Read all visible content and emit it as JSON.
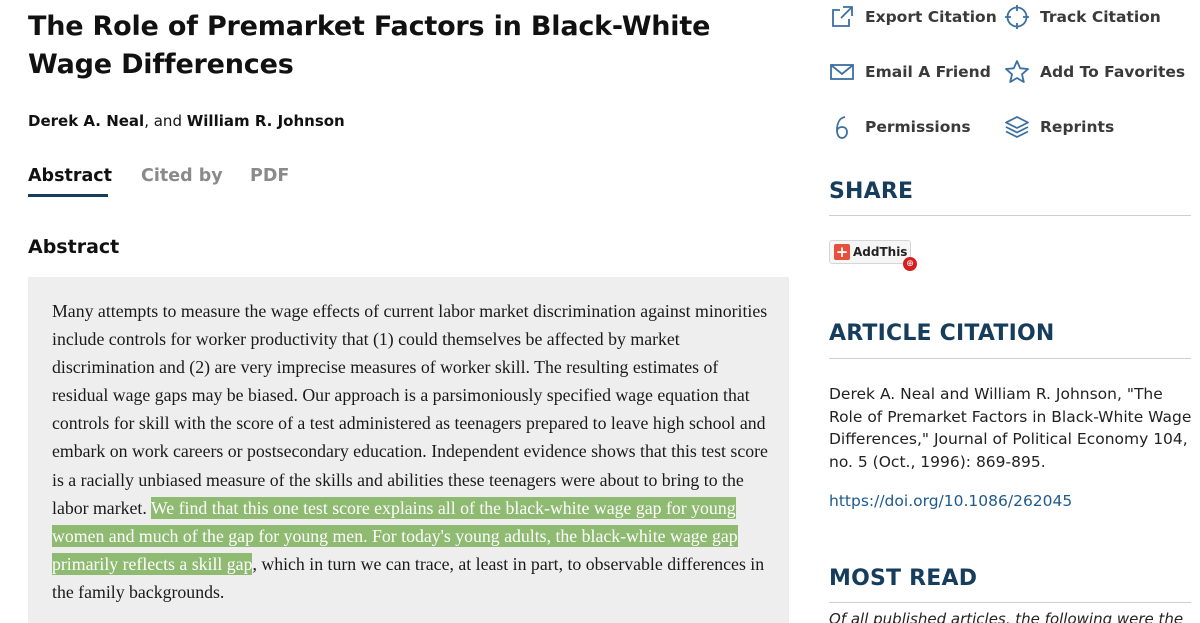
{
  "article": {
    "title": "The Role of Premarket Factors in Black-White Wage Differences",
    "authors": [
      {
        "name": "Derek A. Neal"
      },
      {
        "name": "William R. Johnson"
      }
    ],
    "author_separator": ", and "
  },
  "tabs": [
    {
      "label": "Abstract",
      "active": true
    },
    {
      "label": "Cited by",
      "active": false
    },
    {
      "label": "PDF",
      "active": false
    }
  ],
  "abstract": {
    "heading": "Abstract",
    "text_before": "Many attempts to measure the wage effects of current labor market discrimination against minorities include controls for worker productivity that (1) could themselves be affected by market discrimination and (2) are very imprecise measures of worker skill. The resulting estimates of residual wage gaps may be biased. Our approach is a parsimoniously specified wage equation that controls for skill with the score of a test administered as teenagers prepared to leave high school and embark on work careers or postsecondary education. Independent evidence shows that this test score is a racially unbiased measure of the skills and abilities these teenagers were about to bring to the labor market. ",
    "text_highlighted": "We find that this one test score explains all of the black-white wage gap for young women and much of the gap for young men. For today's young adults, the black-white wage gap primarily reflects a skill gap",
    "text_after": ", which in turn we can trace, at least in part, to observable differences in the family backgrounds.",
    "highlight_color": "#8fba72"
  },
  "tools": {
    "export_citation": {
      "label": "Export Citation",
      "icon": "export-icon"
    },
    "track_citation": {
      "label": "Track Citation",
      "icon": "crosshair-icon"
    },
    "email_friend": {
      "label": "Email A Friend",
      "icon": "envelope-icon"
    },
    "add_favorites": {
      "label": "Add To Favorites",
      "icon": "star-icon"
    },
    "permissions": {
      "label": "Permissions",
      "icon": "copyright-icon"
    },
    "reprints": {
      "label": "Reprints",
      "icon": "layers-icon"
    }
  },
  "share": {
    "heading": "SHARE",
    "addthis_label": "AddThis",
    "addthis_icon": "plus-icon"
  },
  "article_citation": {
    "heading": "ARTICLE CITATION",
    "text": "Derek A. Neal and William R. Johnson, \"The Role of Premarket Factors in Black-White Wage Differences,\" Journal of Political Economy 104, no. 5 (Oct., 1996): 869-895.",
    "doi": "https://doi.org/10.1086/262045"
  },
  "most_read": {
    "heading": "MOST READ",
    "text": "Of all published articles, the following were the"
  },
  "colors": {
    "accent": "#163d5c",
    "link": "#1d5a8f",
    "abstract_bg": "#eeeeee",
    "highlight": "#8fba72"
  }
}
